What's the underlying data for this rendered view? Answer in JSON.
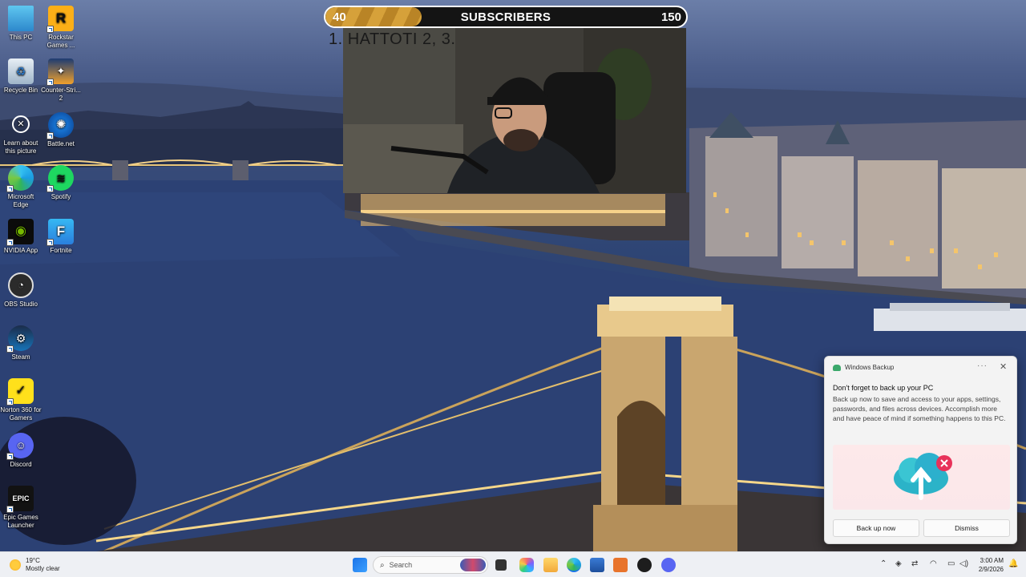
{
  "desktop": {
    "icons": [
      {
        "id": "this-pc",
        "label": "This PC"
      },
      {
        "id": "rockstar",
        "label": "Rockstar Games ..."
      },
      {
        "id": "recycle",
        "label": "Recycle Bin"
      },
      {
        "id": "cs2",
        "label": "Counter-Stri... 2"
      },
      {
        "id": "learn",
        "label": "Learn about this picture"
      },
      {
        "id": "battlenet",
        "label": "Battle.net"
      },
      {
        "id": "edge",
        "label": "Microsoft Edge"
      },
      {
        "id": "spotify",
        "label": "Spotify"
      },
      {
        "id": "nvidia",
        "label": "NVIDIA App"
      },
      {
        "id": "fortnite",
        "label": "Fortnite"
      },
      {
        "id": "obs",
        "label": "OBS Studio"
      },
      {
        "id": "steam",
        "label": "Steam"
      },
      {
        "id": "norton",
        "label": "Norton 360 for Gamers"
      },
      {
        "id": "discord",
        "label": "Discord"
      },
      {
        "id": "epic",
        "label": "Epic Games Launcher"
      }
    ]
  },
  "subscriber_bar": {
    "current": "40",
    "label": "SUBSCRIBERS",
    "goal": "150",
    "progress_fraction": 0.267,
    "fill_color": "#d6a13a"
  },
  "overlay_text": "1.  HATTOTI 2,  3.",
  "toast": {
    "app_name": "Windows Backup",
    "more_glyph": "···",
    "close_glyph": "✕",
    "title": "Don't forget to back up your PC",
    "body": "Back up now to save and access to your apps, settings, passwords, and files across devices. Accomplish more and have peace of mind if something happens to this PC.",
    "primary_button": "Back up now",
    "secondary_button": "Dismiss",
    "hero_icon": "cloud-upload-icon"
  },
  "taskbar": {
    "weather_temp": "19°C",
    "weather_desc": "Mostly clear",
    "search_placeholder": "Search",
    "time": "3:00 AM",
    "date": "2/9/2026"
  }
}
